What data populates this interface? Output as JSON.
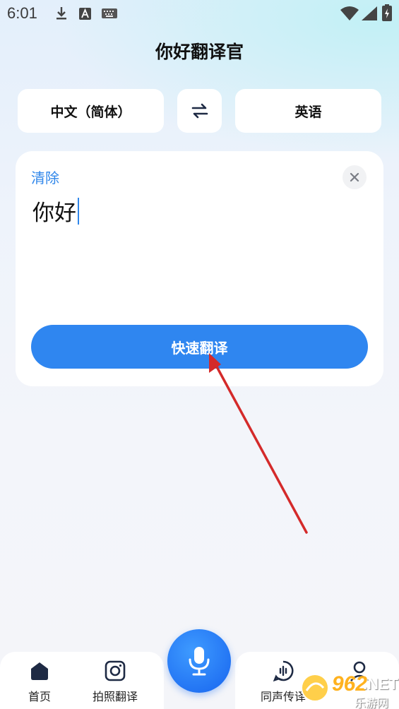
{
  "status_bar": {
    "time": "6:01",
    "icons": [
      "download-icon",
      "a-letter-icon",
      "keyboard-icon",
      "wifi-icon",
      "signal-icon",
      "battery-icon"
    ]
  },
  "header": {
    "title": "你好翻译官"
  },
  "language_bar": {
    "source": "中文（简体）",
    "swap_icon": "swap-arrows-icon",
    "target": "英语"
  },
  "input_card": {
    "clear_label": "清除",
    "close_icon": "close-icon",
    "text": "你好",
    "translate_label": "快速翻译"
  },
  "bottom_nav": {
    "items": [
      {
        "label": "首页",
        "icon": "home-icon"
      },
      {
        "label": "拍照翻译",
        "icon": "camera-icon"
      },
      {
        "label": "同声传译",
        "icon": "voice-bubble-icon"
      },
      {
        "label": "",
        "icon": "user-icon"
      }
    ],
    "mic_icon": "microphone-icon"
  },
  "watermark": {
    "number": "962",
    "net": ".NET",
    "sub": "乐游网"
  },
  "colors": {
    "accent": "#2f86f0",
    "link": "#2f86ea",
    "arrow": "#d42a2a"
  }
}
